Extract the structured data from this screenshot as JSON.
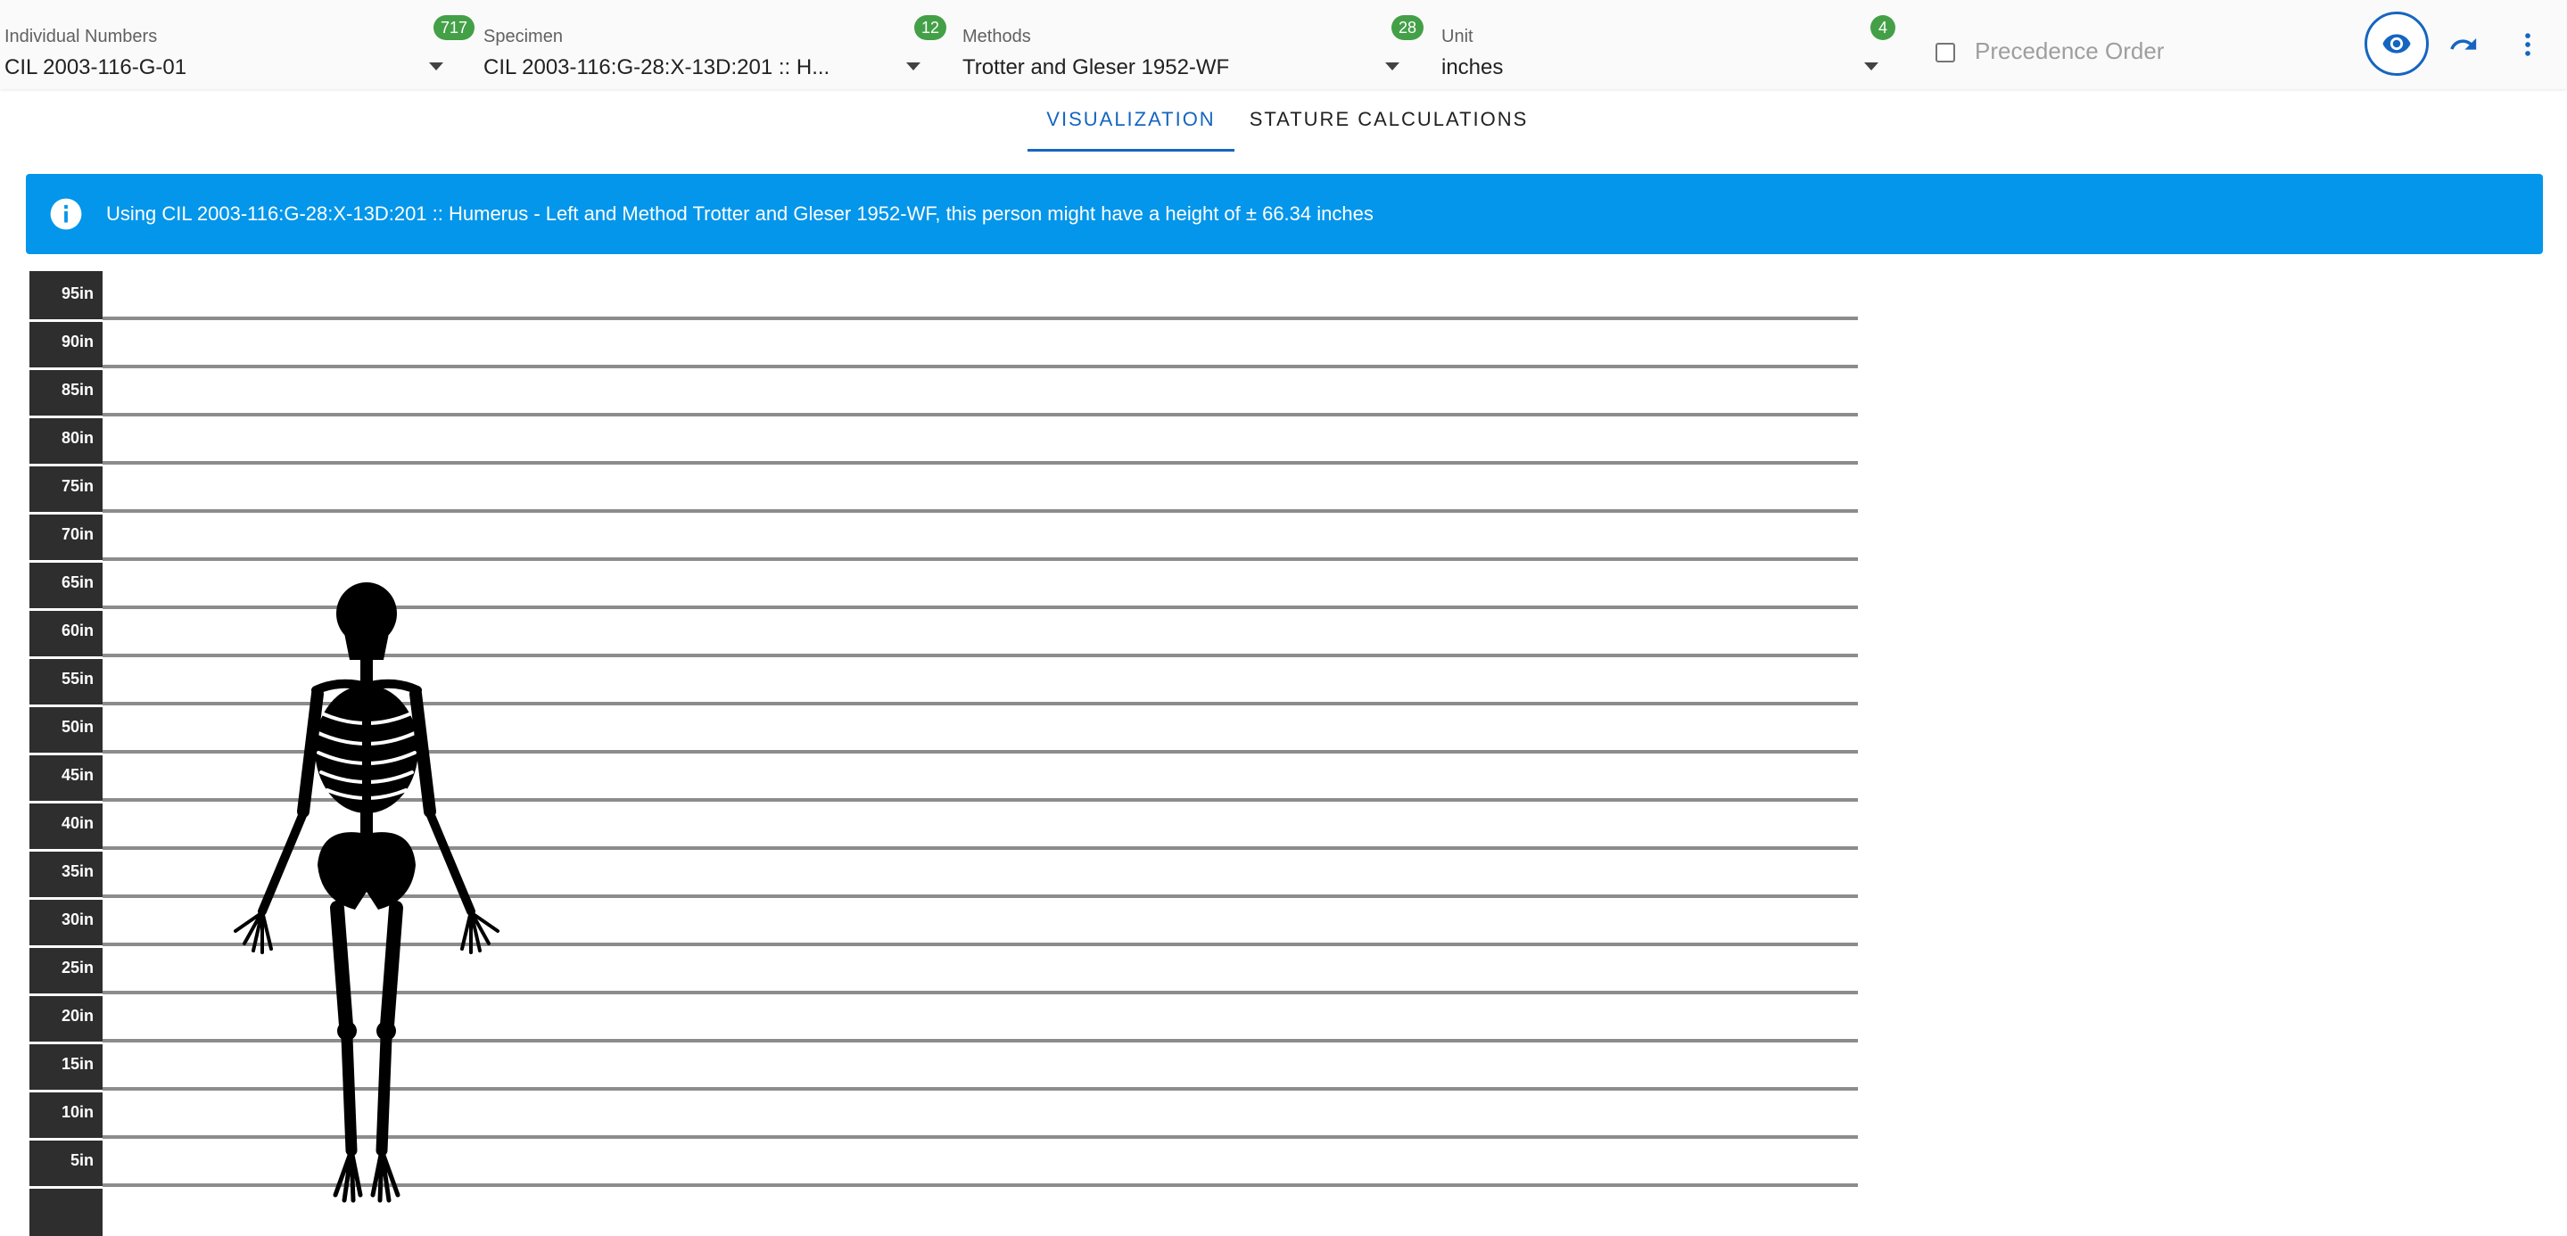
{
  "filters": {
    "individual_numbers": {
      "label": "Individual Numbers",
      "value": "CIL 2003-116-G-01",
      "count": "717"
    },
    "specimen": {
      "label": "Specimen",
      "value": "CIL 2003-116:G-28:X-13D:201 :: H...",
      "count": "12"
    },
    "methods": {
      "label": "Methods",
      "value": "Trotter and Gleser 1952-WF",
      "count": "28"
    },
    "unit": {
      "label": "Unit",
      "value": "inches",
      "count": "4"
    },
    "precedence": {
      "label": "Precedence Order",
      "checked": false
    }
  },
  "toolbar": {
    "icons": [
      "eye-icon",
      "undo-icon",
      "more-vert-icon"
    ],
    "accent": "#1565c0"
  },
  "tabs": [
    {
      "label": "VISUALIZATION",
      "active": true
    },
    {
      "label": "STATURE CALCULATIONS",
      "active": false
    }
  ],
  "alert": {
    "icon": "info-icon",
    "color": "#0396ea",
    "text": "Using CIL 2003-116:G-28:X-13D:201 :: Humerus - Left and Method Trotter and Gleser 1952-WF, this person might have a height of ± 66.34 inches"
  },
  "height_chart": {
    "unit": "in",
    "ticks": [
      "95in",
      "90in",
      "85in",
      "80in",
      "75in",
      "70in",
      "65in",
      "60in",
      "55in",
      "50in",
      "45in",
      "40in",
      "35in",
      "30in",
      "25in",
      "20in",
      "15in",
      "10in",
      "5in"
    ],
    "estimated_height": 66.34,
    "figure": "skeleton-figure"
  }
}
